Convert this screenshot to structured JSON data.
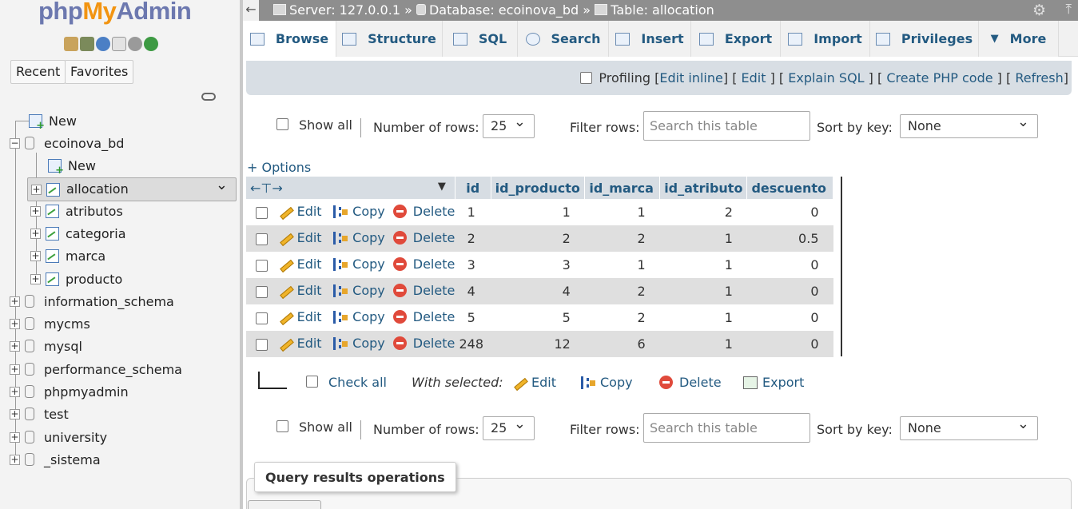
{
  "logo": {
    "php": "php",
    "my": "My",
    "admin": "Admin"
  },
  "nav_buttons": {
    "recent": "Recent",
    "favorites": "Favorites"
  },
  "tree": {
    "new_top": "New",
    "db_ecoinova": "ecoinova_bd",
    "new_child": "New",
    "tables": [
      "allocation",
      "atributos",
      "categoria",
      "marca",
      "producto"
    ],
    "other_dbs": [
      "information_schema",
      "mycms",
      "mysql",
      "performance_schema",
      "phpmyadmin",
      "test",
      "university",
      "_sistema"
    ]
  },
  "breadcrumb": {
    "server_label": "Server: 127.0.0.1",
    "sep1": "»",
    "database_label": "Database: ecoinova_bd",
    "sep2": "»",
    "table_label": "Table: allocation"
  },
  "tabs": [
    "Browse",
    "Structure",
    "SQL",
    "Search",
    "Insert",
    "Export",
    "Import",
    "Privileges",
    "More"
  ],
  "profiling": {
    "label": "Profiling",
    "edit_inline": "Edit inline",
    "edit": "Edit",
    "explain_sql": "Explain SQL",
    "create_php": "Create PHP code",
    "refresh": "Refresh"
  },
  "navigation": {
    "show_all": "Show all",
    "rows_label": "Number of rows:",
    "rows_value": "25",
    "filter_label": "Filter rows:",
    "filter_placeholder": "Search this table",
    "sort_label": "Sort by key:",
    "sort_value": "None"
  },
  "options_link": "+ Options",
  "table": {
    "columns": [
      "id",
      "id_producto",
      "id_marca",
      "id_atributo",
      "descuento"
    ],
    "actions": {
      "edit": "Edit",
      "copy": "Copy",
      "delete": "Delete"
    },
    "rows": [
      [
        "1",
        "1",
        "1",
        "2",
        "0"
      ],
      [
        "2",
        "2",
        "2",
        "1",
        "0.5"
      ],
      [
        "3",
        "3",
        "1",
        "1",
        "0"
      ],
      [
        "4",
        "4",
        "2",
        "1",
        "0"
      ],
      [
        "5",
        "5",
        "2",
        "1",
        "0"
      ],
      [
        "248",
        "12",
        "6",
        "1",
        "0"
      ]
    ]
  },
  "with_selected": {
    "check_all": "Check all",
    "label": "With selected:",
    "edit": "Edit",
    "copy": "Copy",
    "delete": "Delete",
    "export": "Export"
  },
  "query_results_operations": "Query results operations"
}
